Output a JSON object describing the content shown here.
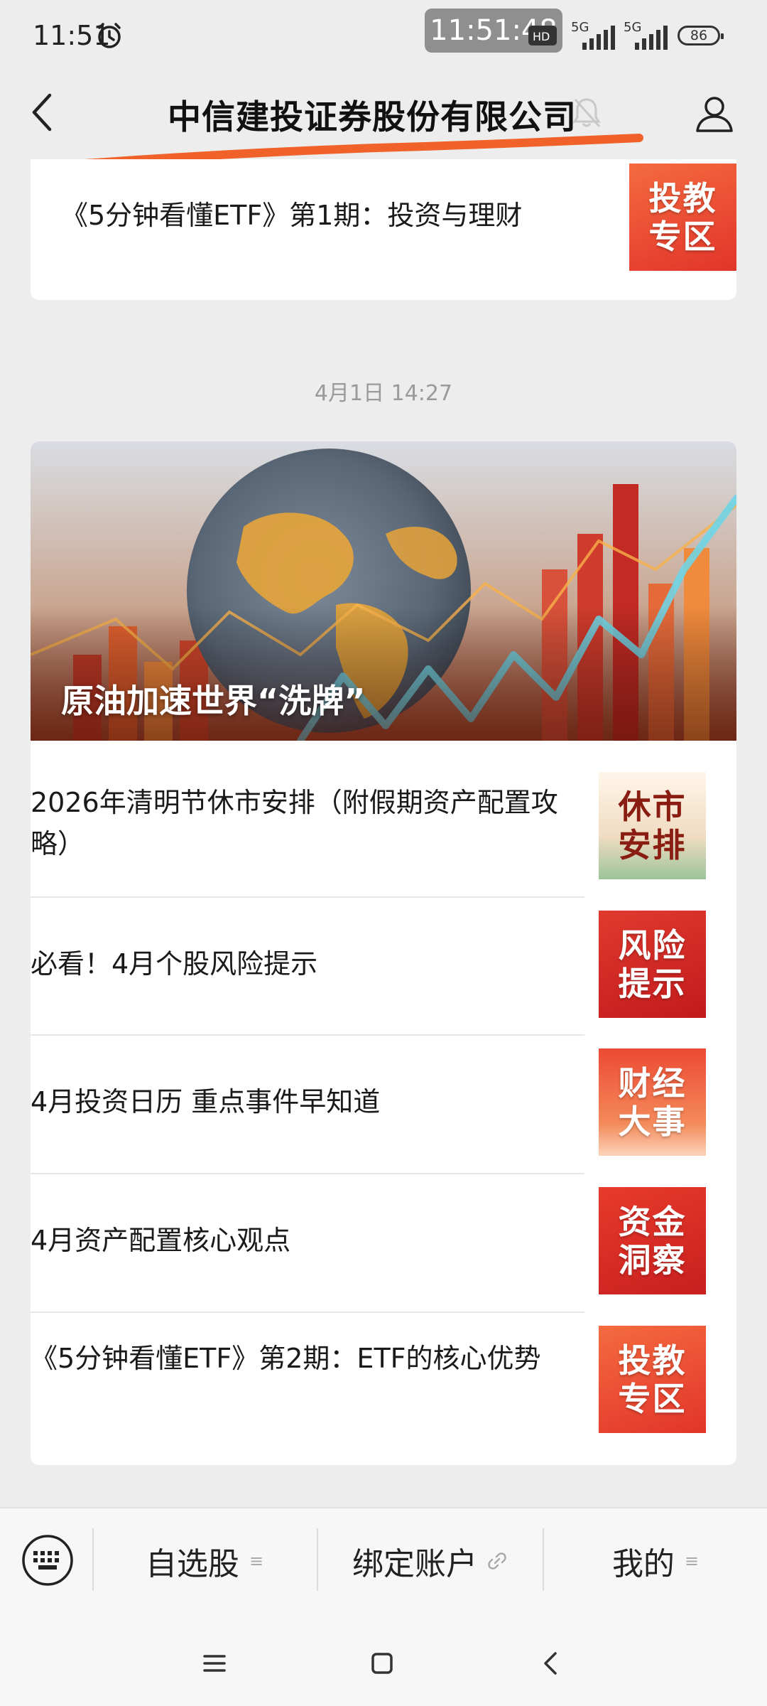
{
  "status_bar": {
    "time": "11:51",
    "overlay_time": "11:51:48",
    "hd": "HD",
    "network1": "5G",
    "network2": "5G",
    "battery": "86"
  },
  "header": {
    "title": "中信建投证券股份有限公司"
  },
  "top_card": {
    "article": {
      "title": "《5分钟看懂ETF》第1期：投资与理财",
      "thumb": "投教\n专区"
    }
  },
  "timestamp": "4月1日 14:27",
  "feature": {
    "hero_title": "原油加速世界“洗牌”",
    "articles": [
      {
        "title": "2026年清明节休市安排（附假期资产配置攻略）",
        "thumb": "休市\n安排"
      },
      {
        "title": "必看！4月个股风险提示",
        "thumb": "风险\n提示"
      },
      {
        "title": "4月投资日历 重点事件早知道",
        "thumb": "财经\n大事"
      },
      {
        "title": "4月资产配置核心观点",
        "thumb": "资金\n洞察"
      },
      {
        "title": "《5分钟看懂ETF》第2期：ETF的核心优势",
        "thumb": "投教\n专区"
      }
    ]
  },
  "bottom_menu": {
    "items": [
      {
        "label": "自选股",
        "icon": "list-icon"
      },
      {
        "label": "绑定账户",
        "icon": "link-icon"
      },
      {
        "label": "我的",
        "icon": "list-icon"
      }
    ]
  },
  "colors": {
    "accent_orange": "#f0622a",
    "thumb_red": "#e8392e",
    "background": "#ededed"
  }
}
